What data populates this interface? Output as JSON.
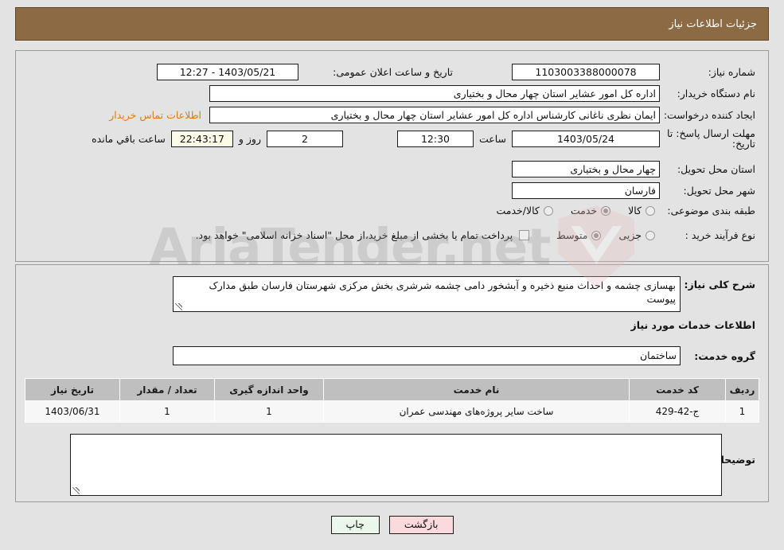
{
  "header": {
    "title": "جزئیات اطلاعات نیاز"
  },
  "top_panel": {
    "need_number_label": "شماره نیاز:",
    "need_number_value": "1103003388000078",
    "announce_datetime_label": "تاریخ و ساعت اعلان عمومی:",
    "announce_datetime_value": "1403/05/21 - 12:27",
    "buyer_org_label": "نام دستگاه خریدار:",
    "buyer_org_value": "اداره کل امور عشایر استان چهار محال و بختیاری",
    "creator_label": "ایجاد کننده درخواست:",
    "creator_value": "ایمان نظری ناغانی کارشناس اداره کل امور عشایر استان چهار محال و بختیاری",
    "contact_link": "اطلاعات تماس خریدار",
    "deadline_label": "مهلت ارسال پاسخ: تا تاریخ:",
    "deadline_date": "1403/05/24",
    "deadline_time_label": "ساعت",
    "deadline_time": "12:30",
    "days_value": "2",
    "days_unit": "روز و",
    "remaining_time": "22:43:17",
    "remaining_label": "ساعت باقي مانده",
    "province_label": "استان محل تحویل:",
    "province_value": "چهار محال و بختیاری",
    "city_label": "شهر محل تحویل:",
    "city_value": "فارسان",
    "category_label": "طبقه بندی موضوعی:",
    "category_options": [
      {
        "label": "کالا",
        "selected": false
      },
      {
        "label": "خدمت",
        "selected": true
      },
      {
        "label": "کالا/خدمت",
        "selected": false
      }
    ],
    "process_label": "نوع فرآیند خرید :",
    "process_options": [
      {
        "label": "جزیی",
        "selected": false
      },
      {
        "label": "متوسط",
        "selected": true
      }
    ],
    "treasury_checkbox_text": "پرداخت تمام یا بخشی از مبلغ خرید،از محل \"اسناد خزانه اسلامی\" خواهد بود.",
    "treasury_checked": false
  },
  "mid_panel": {
    "general_desc_label": "شرح کلی نیاز:",
    "general_desc_value": "بهسازی چشمه و احداث منبع ذخیره و آبشخور دامی چشمه شرشری بخش مرکزی شهرستان فارسان طبق مدارک پیوست",
    "services_heading": "اطلاعات خدمات مورد نیاز",
    "service_group_label": "گروه خدمت:",
    "service_group_value": "ساختمان",
    "table": {
      "columns": [
        "ردیف",
        "کد خدمت",
        "نام خدمت",
        "واحد اندازه گیری",
        "تعداد / مقدار",
        "تاریخ نیاز"
      ],
      "rows": [
        {
          "row_no": "1",
          "service_code": "ج-42-429",
          "service_name": "ساخت سایر پروژه‌های مهندسی عمران",
          "unit": "1",
          "quantity": "1",
          "need_date": "1403/06/31"
        }
      ]
    },
    "buyer_notes_label": "توضیحات خریدار:",
    "buyer_notes_value": ""
  },
  "footer": {
    "back_button": "بازگشت",
    "print_button": "چاپ"
  },
  "watermark": {
    "text": "AriaTender.net"
  },
  "colors": {
    "header_bg": "#8c6a44",
    "panel_bg": "#e3e3e3",
    "link_orange": "#d97c12",
    "table_header_bg": "#bfbfbf",
    "btn_back_bg": "#fadadd",
    "btn_print_bg": "#eaf7ea",
    "timer_bg": "#fbfbe8"
  }
}
